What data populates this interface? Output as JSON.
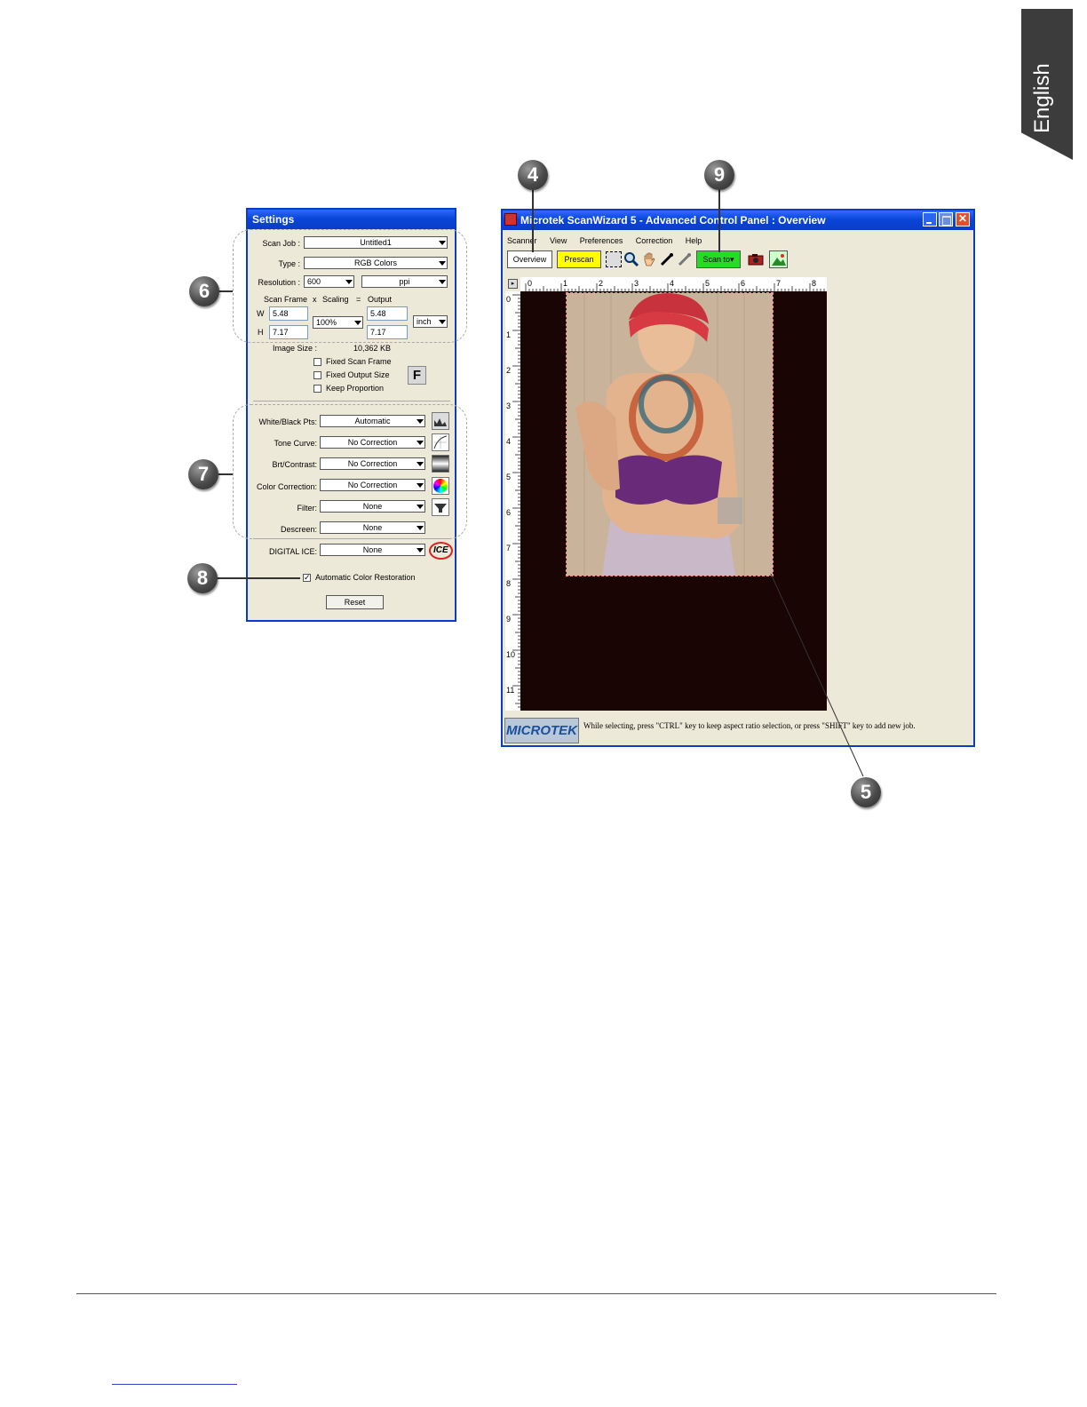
{
  "side_tab": {
    "label": "English"
  },
  "callouts": {
    "c4": "4",
    "c5": "5",
    "c6": "6",
    "c7": "7",
    "c8": "8",
    "c9": "9"
  },
  "settings": {
    "title": "Settings",
    "scan_job_label": "Scan Job :",
    "scan_job_value": "Untitled1",
    "type_label": "Type :",
    "type_value": "RGB Colors",
    "resolution_label": "Resolution :",
    "resolution_value": "600",
    "resolution_unit": "ppi",
    "scan_frame_label": "Scan Frame",
    "times": "x",
    "scaling_label": "Scaling",
    "equals": "=",
    "output_label": "Output",
    "w_label": "W",
    "h_label": "H",
    "frame_w": "5.48",
    "frame_h": "7.17",
    "scaling_value": "100%",
    "output_w": "5.48",
    "output_h": "7.17",
    "unit_value": "inch",
    "image_size_label": "Image Size :",
    "image_size_value": "10,362 KB",
    "fixed_scan_frame": "Fixed Scan Frame",
    "fixed_output_size": "Fixed Output Size",
    "keep_proportion": "Keep Proportion",
    "f_button": "F",
    "white_black_label": "White/Black Pts:",
    "white_black_value": "Automatic",
    "tone_curve_label": "Tone Curve:",
    "tone_curve_value": "No Correction",
    "brt_contrast_label": "Brt/Contrast:",
    "brt_contrast_value": "No Correction",
    "color_correction_label": "Color Correction:",
    "color_correction_value": "No Correction",
    "filter_label": "Filter:",
    "filter_value": "None",
    "descreen_label": "Descreen:",
    "descreen_value": "None",
    "digital_ice_label": "DIGITAL ICE:",
    "digital_ice_value": "None",
    "ice_logo": "ICE",
    "auto_color_restoration": "Automatic Color Restoration",
    "auto_color_checked": "✓",
    "reset_button": "Reset"
  },
  "main_window": {
    "title": "Microtek ScanWizard 5 - Advanced Control Panel : Overview",
    "menu": [
      "Scanner",
      "View",
      "Preferences",
      "Correction",
      "Help"
    ],
    "toolbar": {
      "overview": "Overview",
      "prescan": "Prescan",
      "scan_to": "Scan to"
    },
    "ruler_x": [
      "0",
      "1",
      "2",
      "3",
      "4",
      "5",
      "6",
      "7",
      "8"
    ],
    "ruler_y": [
      "0",
      "1",
      "2",
      "3",
      "4",
      "5",
      "6",
      "7",
      "8",
      "9",
      "10",
      "11"
    ],
    "brand": "MICROTEK",
    "status_text": "While selecting, press \"CTRL\" key to keep aspect ratio selection, or press \"SHIFT\" key to add new job.",
    "colors": {
      "prescan": "#ffff00",
      "scan_to": "#22dd22",
      "preview_bg": "#1a0505"
    }
  }
}
